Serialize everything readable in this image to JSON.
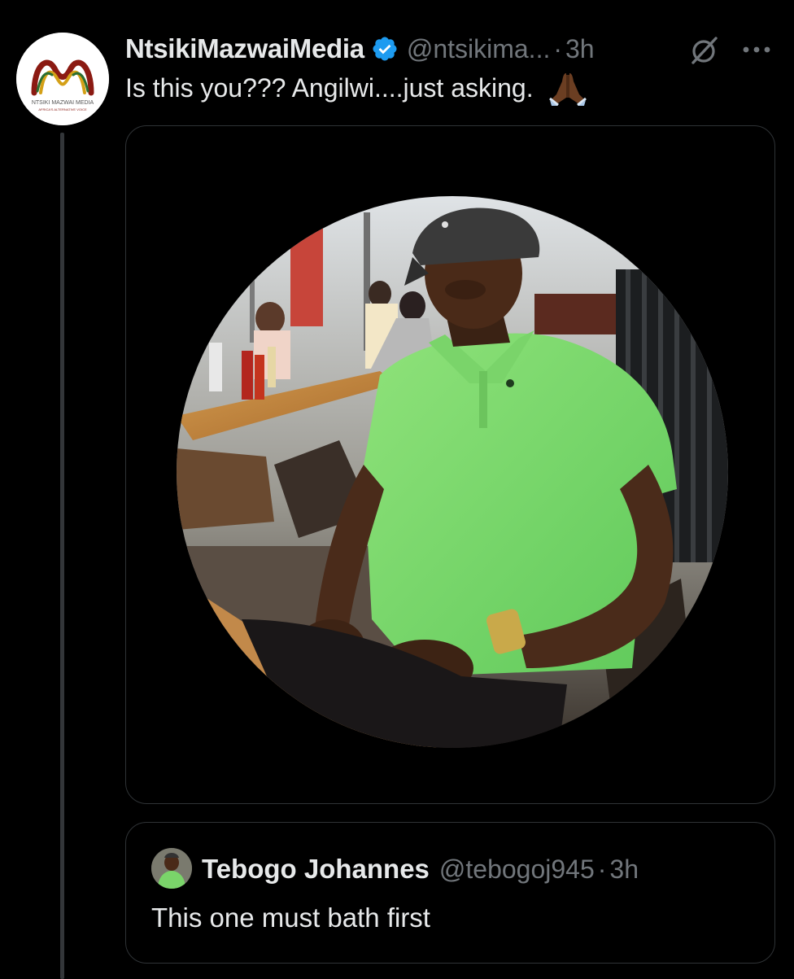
{
  "tweet": {
    "display_name": "NtsikiMazwaiMedia",
    "handle": "@ntsikima...",
    "separator": "·",
    "time": "3h",
    "text": "Is this you??? Angilwi....just asking.",
    "emoji": "folded-hands-emoji",
    "verified": true,
    "avatar_logo_text": "NTSIKI MAZWAI MEDIA",
    "avatar_logo_subtext": "AFRICA'S ALTERNATIVE VOICE",
    "photo_description": "man-in-green-polo-shirt-photo"
  },
  "quoted_tweet": {
    "display_name": "Tebogo Johannes",
    "handle": "@tebogoj945",
    "separator": "·",
    "time": "3h",
    "text": "This one must bath first"
  },
  "colors": {
    "background": "#000000",
    "text_primary": "#e7e9ea",
    "text_secondary": "#71767b",
    "verified_blue": "#1d9bf0",
    "border": "#2f3336"
  },
  "icons": [
    "verified-badge-icon",
    "grok-icon",
    "more-options-icon",
    "folded-hands-emoji"
  ]
}
